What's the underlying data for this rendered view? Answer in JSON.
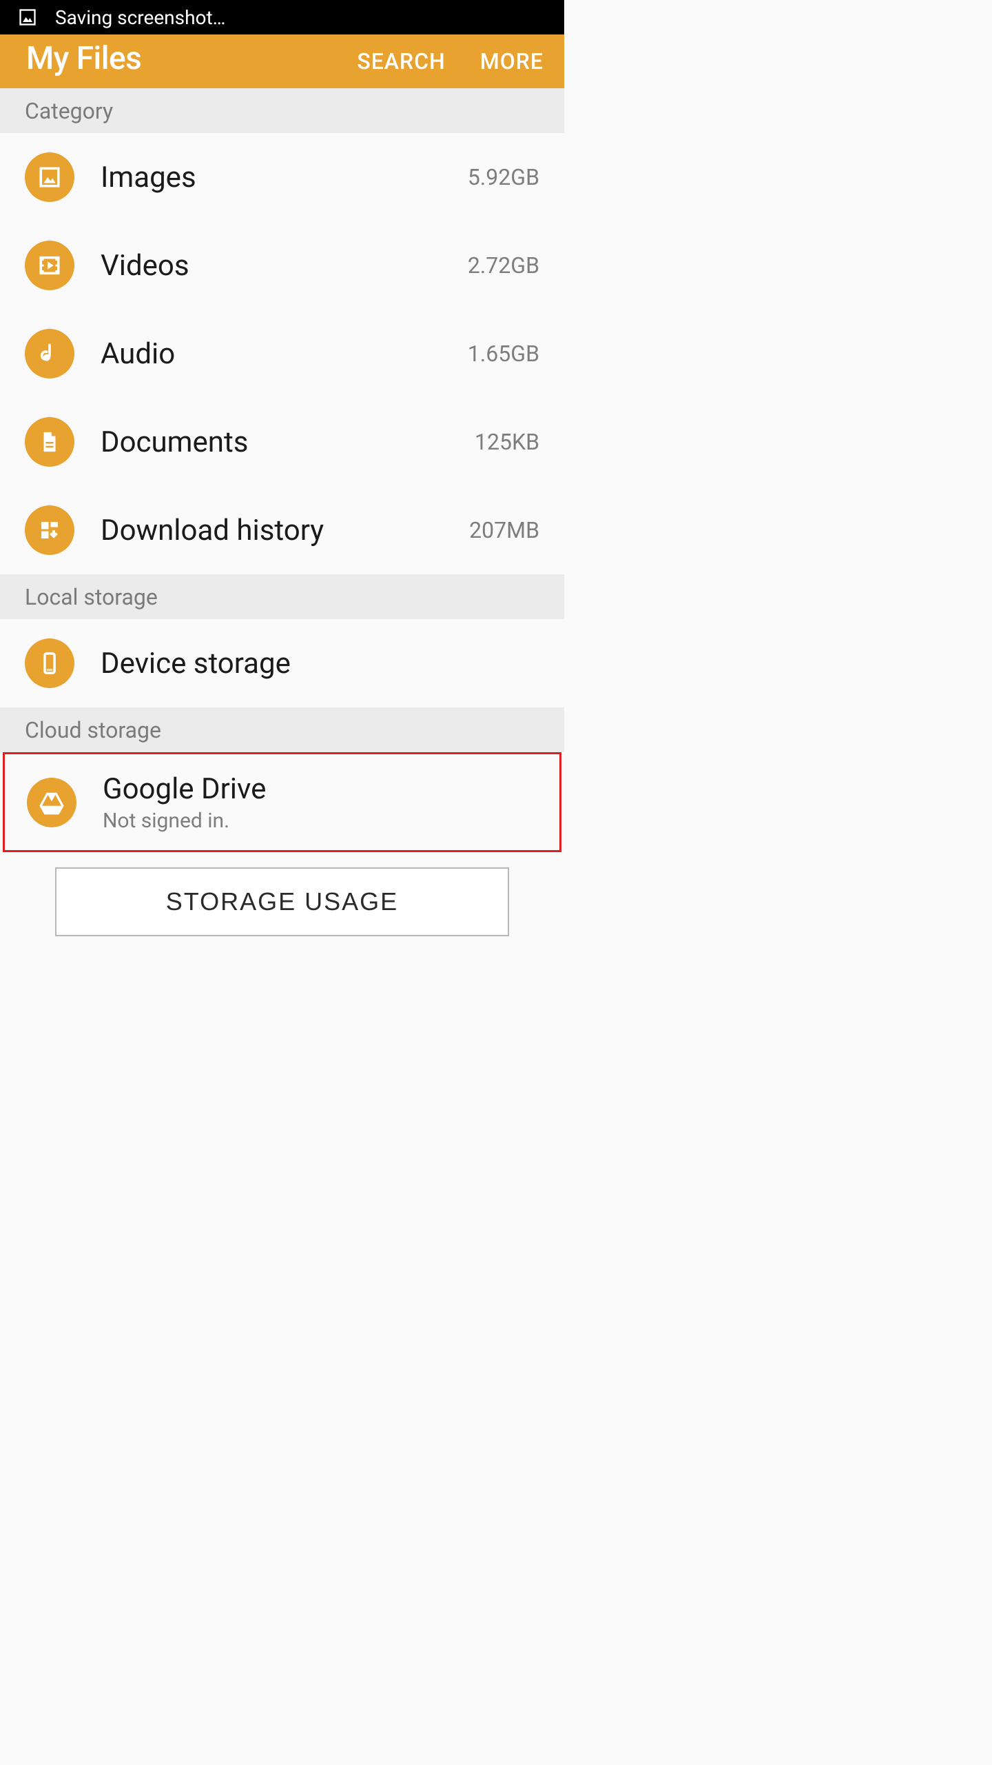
{
  "statusBar": {
    "text": "Saving screenshot…"
  },
  "appBar": {
    "title": "My Files",
    "search": "SEARCH",
    "more": "MORE"
  },
  "sections": {
    "category": "Category",
    "local": "Local storage",
    "cloud": "Cloud storage"
  },
  "items": {
    "images": {
      "label": "Images",
      "size": "5.92GB"
    },
    "videos": {
      "label": "Videos",
      "size": "2.72GB"
    },
    "audio": {
      "label": "Audio",
      "size": "1.65GB"
    },
    "documents": {
      "label": "Documents",
      "size": "125KB"
    },
    "download": {
      "label": "Download history",
      "size": "207MB"
    },
    "device": {
      "label": "Device storage"
    },
    "gdrive": {
      "label": "Google Drive",
      "sub": "Not signed in."
    }
  },
  "storageBtn": "STORAGE USAGE"
}
